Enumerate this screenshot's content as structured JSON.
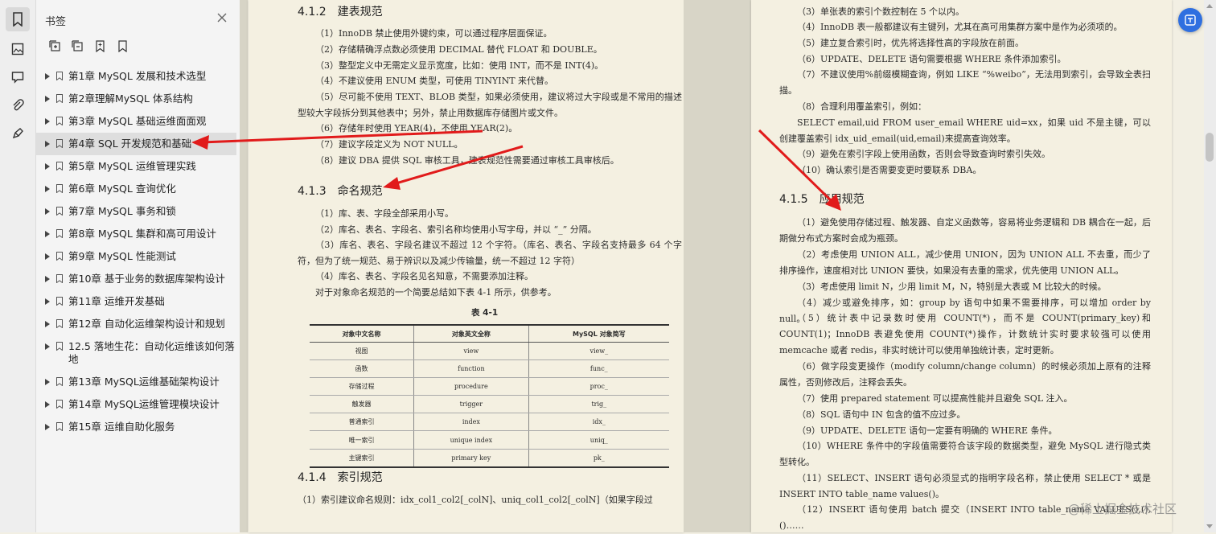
{
  "sidebar": {
    "title": "书签",
    "rail_icons": [
      "bookmark-icon",
      "thumbnail-icon",
      "comment-icon",
      "attachment-icon",
      "sign-icon"
    ],
    "tool_icons": [
      "expand-all-icon",
      "collapse-all-icon",
      "add-bookmark-icon",
      "bookmark-settings-icon"
    ],
    "items": [
      {
        "label": "第1章 MySQL 发展和技术选型"
      },
      {
        "label": "第2章理解MySQL 体系结构"
      },
      {
        "label": "第3章 MySQL 基础运维面面观"
      },
      {
        "label": "第4章 SQL 开发规范和基础",
        "selected": true
      },
      {
        "label": "第5章 MySQL 运维管理实践"
      },
      {
        "label": "第6章 MySQL 查询优化"
      },
      {
        "label": "第7章 MySQL 事务和锁"
      },
      {
        "label": "第8章 MySQL 集群和高可用设计"
      },
      {
        "label": "第9章 MySQL 性能测试"
      },
      {
        "label": "第10章 基于业务的数据库架构设计"
      },
      {
        "label": "第11章 运维开发基础"
      },
      {
        "label": "第12章 自动化运维架构设计和规划"
      },
      {
        "label": "12.5 落地生花：自动化运维该如何落地"
      },
      {
        "label": "第13章 MySQL运维基础架构设计"
      },
      {
        "label": "第14章 MySQL运维管理模块设计"
      },
      {
        "label": "第15章 运维自助化服务"
      }
    ]
  },
  "left_page": {
    "s412": {
      "num": "4.1.2",
      "title": "建表规范"
    },
    "s412_lines": [
      "（1）InnoDB 禁止使用外键约束，可以通过程序层面保证。",
      "（2）存储精确浮点数必须使用 DECIMAL 替代 FLOAT 和 DOUBLE。",
      "（3）整型定义中无需定义显示宽度，比如：使用 INT，而不是 INT(4)。",
      "（4）不建议使用 ENUM 类型，可使用 TINYINT 来代替。",
      "（5）尽可能不使用 TEXT、BLOB 类型，如果必须使用，建议将过大字段或是不常用的描述型较大字段拆分到其他表中；另外，禁止用数据库存储图片或文件。",
      "（6）存储年时使用 YEAR(4)，不使用 YEAR(2)。",
      "（7）建议字段定义为 NOT NULL。",
      "（8）建议 DBA 提供 SQL 审核工具，建表规范性需要通过审核工具审核后。"
    ],
    "s413": {
      "num": "4.1.3",
      "title": "命名规范"
    },
    "s413_lines": [
      "（1）库、表、字段全部采用小写。",
      "（2）库名、表名、字段名、索引名称均使用小写字母，并以 “_” 分隔。",
      "（3）库名、表名、字段名建议不超过 12 个字符。（库名、表名、字段名支持最多 64 个字符，但为了统一规范、易于辨识以及减少传输量，统一不超过 12 字符）",
      "（4）库名、表名、字段名见名知意，不需要添加注释。",
      "对于对象命名规范的一个简要总结如下表 4-1 所示，供参考。"
    ],
    "table_caption": "表 4-1",
    "table_headers": [
      "对象中文名称",
      "对象英文全称",
      "MySQL 对象简写"
    ],
    "table_rows": [
      [
        "视图",
        "view",
        "view_"
      ],
      [
        "函数",
        "function",
        "func_"
      ],
      [
        "存储过程",
        "procedure",
        "proc_"
      ],
      [
        "触发器",
        "trigger",
        "trig_"
      ],
      [
        "普通索引",
        "index",
        "idx_"
      ],
      [
        "唯一索引",
        "unique index",
        "uniq_"
      ],
      [
        "主键索引",
        "primary key",
        "pk_"
      ]
    ],
    "s414": {
      "num": "4.1.4",
      "title": "索引规范"
    },
    "s414_line": "（1）索引建议命名规则：idx_col1_col2[_colN]、uniq_col1_col2[_colN]（如果字段过"
  },
  "right_page": {
    "lines_top": [
      "（3）单张表的索引个数控制在 5 个以内。",
      "（4）InnoDB 表一般都建议有主键列，尤其在高可用集群方案中是作为必须项的。",
      "（5）建立复合索引时，优先将选择性高的字段放在前面。",
      "（6）UPDATE、DELETE 语句需要根据 WHERE 条件添加索引。",
      "（7）不建议使用%前缀模糊查询，例如 LIKE “%weibo”，无法用到索引，会导致全表扫描。",
      "（8）合理利用覆盖索引，例如：",
      "SELECT email,uid FROM user_email WHERE uid=xx，如果 uid 不是主键，可以创建覆盖索引 idx_uid_email(uid,email)来提高查询效率。",
      "（9）避免在索引字段上使用函数，否则会导致查询时索引失效。",
      "（10）确认索引是否需要变更时要联系 DBA。"
    ],
    "s415": {
      "num": "4.1.5",
      "title": "应用规范"
    },
    "s415_lines": [
      "（1）避免使用存储过程、触发器、自定义函数等，容易将业务逻辑和 DB 耦合在一起，后期做分布式方案时会成为瓶颈。",
      "（2）考虑使用 UNION ALL，减少使用 UNION，因为 UNION ALL 不去重，而少了排序操作，速度相对比 UNION 要快，如果没有去重的需求，优先使用 UNION ALL。",
      "（3）考虑使用 limit N，少用 limit M，N，特别是大表或 M 比较大的时候。",
      "（4）减少或避免排序，如：group by 语句中如果不需要排序，可以增加 order by null。",
      "（5）统计表中记录数时使用 COUNT(*)，而不是 COUNT(primary_key)和 COUNT(1)；InnoDB 表避免使用 COUNT(*)操作，计数统计实时要求较强可以使用 memcache 或者 redis，非实时统计可以使用单独统计表，定时更新。",
      "（6）做字段变更操作（modify column/change column）的时候必须加上原有的注释属性，否则修改后，注释会丢失。",
      "（7）使用 prepared statement 可以提高性能并且避免 SQL 注入。",
      "（8）SQL 语句中 IN 包含的值不应过多。",
      "（9）UPDATE、DELETE 语句一定要有明确的 WHERE 条件。",
      "（10）WHERE 条件中的字段值需要符合该字段的数据类型，避免 MySQL 进行隐式类型转化。",
      "（11）SELECT、INSERT 语句必须显式的指明字段名称，禁止使用 SELECT * 或是 INSERT INTO table_name values()。",
      "（12）INSERT 语句使用 batch 提交（INSERT INTO table_name VALUES(),(),()……"
    ]
  },
  "watermark": "@稀土掘金技术社区",
  "colors": {
    "arrow": "#e11b1b",
    "page": "#f4f0e1",
    "accent": "#2f6fe0"
  }
}
